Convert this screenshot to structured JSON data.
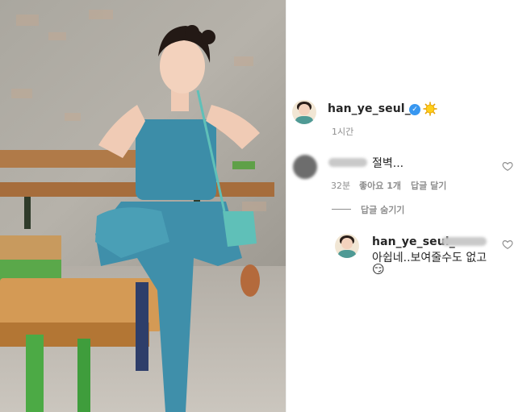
{
  "post": {
    "author": "han_ye_seul_",
    "sun_emoji": "sun-emoji",
    "verified_mark": "✓",
    "time": "1시간"
  },
  "comment": {
    "text": "절벽...",
    "time": "32분",
    "likes": "좋아요 1개",
    "reply": "답글 달기"
  },
  "replies_toggle": "답글 숨기기",
  "reply": {
    "author": "han_ye_seul_",
    "text": "아쉽네..보여줄수도 없고",
    "emoji": "😏"
  },
  "colors": {
    "accent": "#3897f0",
    "muted": "#8e8e8e",
    "text": "#262626"
  }
}
